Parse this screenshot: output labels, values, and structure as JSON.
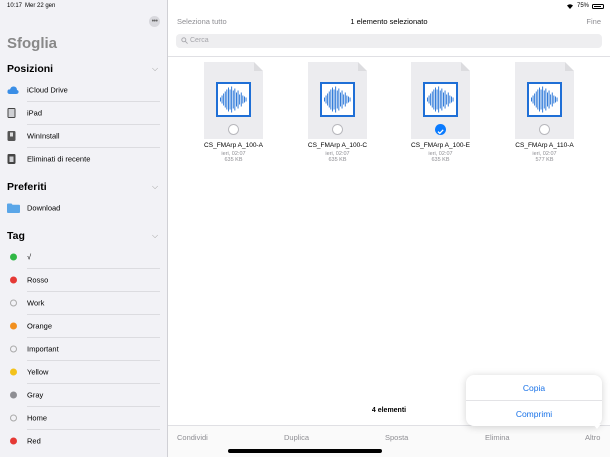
{
  "status": {
    "time": "10:17",
    "date": "Mer 22 gen",
    "battery": "75%"
  },
  "sidebar": {
    "title": "Sfoglia",
    "more_icon": "ellipsis-icon",
    "sections": {
      "posizioni": {
        "title": "Posizioni",
        "items": [
          {
            "label": "iCloud Drive",
            "icon": "icloud-icon"
          },
          {
            "label": "iPad",
            "icon": "ipad-icon"
          },
          {
            "label": "WinInstall",
            "icon": "usb-drive-icon"
          },
          {
            "label": "Eliminati di recente",
            "icon": "trash-icon"
          }
        ]
      },
      "preferiti": {
        "title": "Preferiti",
        "items": [
          {
            "label": "Download",
            "icon": "folder-icon"
          }
        ]
      },
      "tag": {
        "title": "Tag",
        "items": [
          {
            "label": "√",
            "color": "#30b845"
          },
          {
            "label": "Rosso",
            "color": "#e53935"
          },
          {
            "label": "Work",
            "color": ""
          },
          {
            "label": "Orange",
            "color": "#f2901f"
          },
          {
            "label": "Important",
            "color": ""
          },
          {
            "label": "Yellow",
            "color": "#f3c21b"
          },
          {
            "label": "Gray",
            "color": "#8e8e93"
          },
          {
            "label": "Home",
            "color": ""
          },
          {
            "label": "Red",
            "color": "#e53935"
          }
        ]
      }
    }
  },
  "header": {
    "select_all": "Seleziona tutto",
    "title": "1 elemento selezionato",
    "done": "Fine"
  },
  "search": {
    "placeholder": "Cerca"
  },
  "files": [
    {
      "name": "CS_FMArp A_100-A",
      "date": "ieri, 02:07",
      "size": "635 KB",
      "selected": false
    },
    {
      "name": "CS_FMArp A_100-C",
      "date": "ieri, 02:07",
      "size": "635 KB",
      "selected": false
    },
    {
      "name": "CS_FMArp A_100-E",
      "date": "ieri, 02:07",
      "size": "635 KB",
      "selected": true
    },
    {
      "name": "CS_FMArp A_110-A",
      "date": "ieri, 02:07",
      "size": "577 KB",
      "selected": false
    }
  ],
  "footer": {
    "count": "4 elementi"
  },
  "toolbar": {
    "share": "Condividi",
    "duplicate": "Duplica",
    "move": "Sposta",
    "delete": "Elimina",
    "more": "Altro"
  },
  "popover": {
    "copy": "Copia",
    "compress": "Comprimi"
  },
  "colors": {
    "accent": "#0a7bff",
    "waveform": "#1f6fd6"
  }
}
